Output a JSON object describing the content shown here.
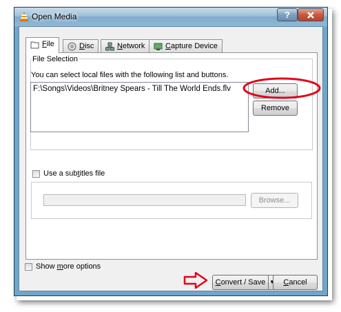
{
  "window": {
    "title": "Open Media",
    "help_glyph": "?",
    "close_glyph": "X"
  },
  "tabs": [
    {
      "label": "File",
      "mnemonic": "F",
      "rest": "ile",
      "icon": "file-icon",
      "active": true
    },
    {
      "label": "Disc",
      "mnemonic": "D",
      "rest": "isc",
      "icon": "disc-icon"
    },
    {
      "label": "Network",
      "mnemonic": "N",
      "rest": "etwork",
      "icon": "network-icon"
    },
    {
      "label": "Capture Device",
      "mnemonic": "C",
      "rest": "apture Device",
      "icon": "capture-device-icon"
    }
  ],
  "file_selection": {
    "group_label": "File Selection",
    "description": "You can select local files with the following list and buttons.",
    "files": [
      "F:\\Songs\\Videos\\Britney Spears - Till The World Ends.flv"
    ],
    "add_label": "Add...",
    "remove_label": "Remove"
  },
  "subtitles": {
    "pre": "Use a sub",
    "mnemonic": "t",
    "post": "itles file",
    "checked": false,
    "browse_label": "Browse..."
  },
  "options": {
    "pre": "Show ",
    "mnemonic": "m",
    "post": "ore options",
    "checked": false
  },
  "footer": {
    "convert_mnemonic": "C",
    "convert_rest": "onvert / Save",
    "dropdown_glyph": "▼",
    "cancel_mnemonic": "C",
    "cancel_rest": "ancel"
  },
  "annotations": {
    "highlight_color": "#e3001b",
    "arrow_color": "#e3001b"
  },
  "icons": {
    "app": "vlc-cone-icon"
  }
}
